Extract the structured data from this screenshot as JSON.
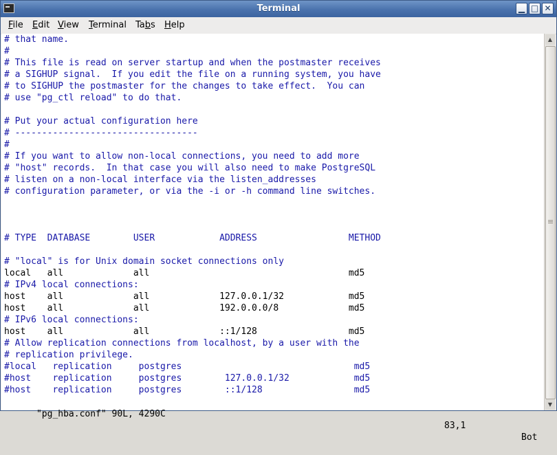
{
  "window": {
    "title": "Terminal"
  },
  "menu": [
    {
      "label": "File",
      "mnemonic_index": 0
    },
    {
      "label": "Edit",
      "mnemonic_index": 0
    },
    {
      "label": "View",
      "mnemonic_index": 0
    },
    {
      "label": "Terminal",
      "mnemonic_index": 0
    },
    {
      "label": "Tabs",
      "mnemonic_index": 2
    },
    {
      "label": "Help",
      "mnemonic_index": 0
    }
  ],
  "colors": {
    "comment": "#1818a8",
    "text": "#000000",
    "titlebar": "#4a72ad"
  },
  "terminal_lines": [
    {
      "text": "# that name.",
      "type": "comment"
    },
    {
      "text": "#",
      "type": "comment"
    },
    {
      "text": "# This file is read on server startup and when the postmaster receives",
      "type": "comment"
    },
    {
      "text": "# a SIGHUP signal.  If you edit the file on a running system, you have",
      "type": "comment"
    },
    {
      "text": "# to SIGHUP the postmaster for the changes to take effect.  You can",
      "type": "comment"
    },
    {
      "text": "# use \"pg_ctl reload\" to do that.",
      "type": "comment"
    },
    {
      "text": "",
      "type": "blank"
    },
    {
      "text": "# Put your actual configuration here",
      "type": "comment"
    },
    {
      "text": "# ----------------------------------",
      "type": "comment"
    },
    {
      "text": "#",
      "type": "comment"
    },
    {
      "text": "# If you want to allow non-local connections, you need to add more",
      "type": "comment"
    },
    {
      "text": "# \"host\" records.  In that case you will also need to make PostgreSQL",
      "type": "comment"
    },
    {
      "text": "# listen on a non-local interface via the listen_addresses",
      "type": "comment"
    },
    {
      "text": "# configuration parameter, or via the -i or -h command line switches.",
      "type": "comment"
    },
    {
      "text": "",
      "type": "blank"
    },
    {
      "text": "",
      "type": "blank"
    },
    {
      "text": "",
      "type": "blank"
    },
    {
      "text": "# TYPE  DATABASE        USER            ADDRESS                 METHOD",
      "type": "comment"
    },
    {
      "text": "",
      "type": "blank"
    },
    {
      "text": "# \"local\" is for Unix domain socket connections only",
      "type": "comment"
    },
    {
      "text": "local   all             all                                     md5",
      "type": "code"
    },
    {
      "text": "# IPv4 local connections:",
      "type": "comment"
    },
    {
      "text": "host    all             all             127.0.0.1/32            md5",
      "type": "code"
    },
    {
      "text": "host    all             all             192.0.0.0/8             md5",
      "type": "code"
    },
    {
      "text": "# IPv6 local connections:",
      "type": "comment"
    },
    {
      "text": "host    all             all             ::1/128                 md5",
      "type": "code"
    },
    {
      "text": "# Allow replication connections from localhost, by a user with the",
      "type": "comment"
    },
    {
      "text": "# replication privilege.",
      "type": "comment"
    },
    {
      "text": "#local   replication     postgres                                md5",
      "type": "comment"
    },
    {
      "text": "#host    replication     postgres        127.0.0.1/32            md5",
      "type": "comment"
    },
    {
      "text": "#host    replication     postgres        ::1/128                 md5",
      "type": "comment"
    }
  ],
  "status": {
    "file": "\"pg_hba.conf\" 90L, 4290C",
    "position": "83,1",
    "scroll": "Bot"
  }
}
